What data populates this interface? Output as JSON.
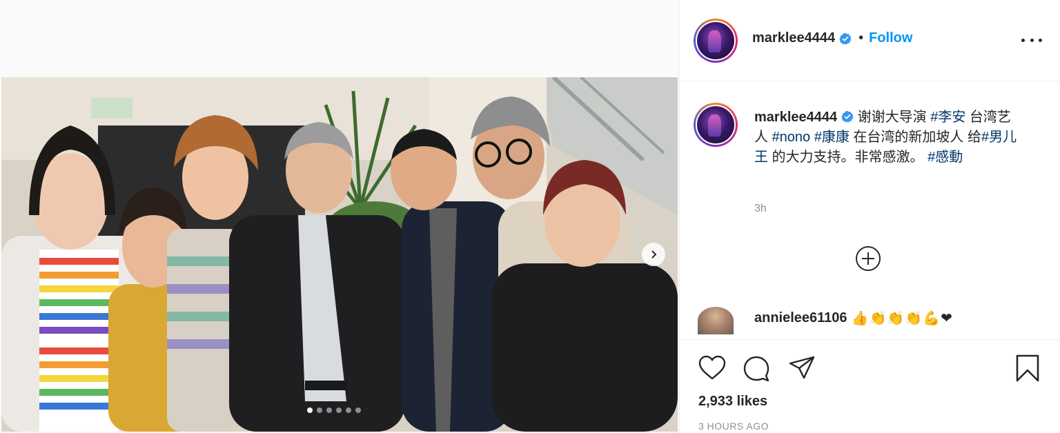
{
  "post": {
    "username": "marklee4444",
    "verified": true,
    "follow_label": "Follow",
    "separator": "•",
    "caption_segments": [
      {
        "text": " 谢谢大导演 ",
        "tag": false
      },
      {
        "text": "#李安",
        "tag": true
      },
      {
        "text": " 台湾艺人 ",
        "tag": false
      },
      {
        "text": "#nono",
        "tag": true
      },
      {
        "text": " ",
        "tag": false
      },
      {
        "text": "#康康",
        "tag": true
      },
      {
        "text": " 在台湾的新加坡人 给",
        "tag": false
      },
      {
        "text": "#男儿王",
        "tag": true
      },
      {
        "text": " 的大力支持。非常感激。 ",
        "tag": false
      },
      {
        "text": "#感動",
        "tag": true
      }
    ],
    "caption_time": "3h",
    "likes": "2,933 likes",
    "posted_ago": "3 HOURS AGO",
    "carousel": {
      "count": 6,
      "active_index": 0
    }
  },
  "comments": [
    {
      "username": "annielee61106",
      "text": "👍👏👏👏💪❤"
    }
  ],
  "icons": {
    "like": "heart-icon",
    "comment": "comment-icon",
    "share": "share-icon",
    "save": "bookmark-icon",
    "more": "more-options-icon",
    "load_more": "plus-circle-icon",
    "verified": "verified-badge-icon",
    "next": "chevron-right-icon"
  },
  "colors": {
    "follow": "#0095f6",
    "text": "#262626",
    "muted": "#8e8e8e",
    "hashtag": "#00376b",
    "verified": "#3897f0"
  }
}
